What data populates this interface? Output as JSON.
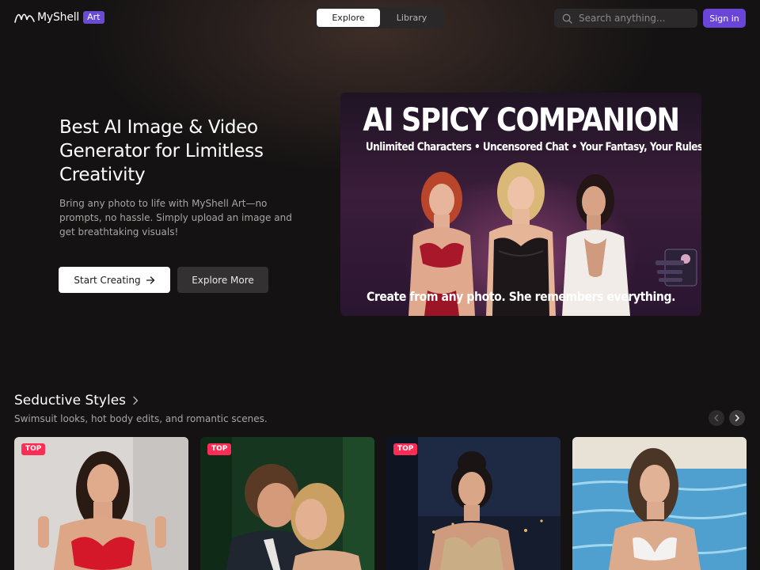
{
  "app": {
    "name": "MyShell",
    "badge": "Art"
  },
  "nav": {
    "tabs": [
      {
        "label": "Explore",
        "active": true
      },
      {
        "label": "Library",
        "active": false
      }
    ]
  },
  "search": {
    "placeholder": "Search anything...",
    "icon": "search-icon"
  },
  "auth": {
    "signin_label": "Sign in"
  },
  "hero": {
    "title_lines": [
      "Best AI Image & Video",
      "Generator for Limitless",
      "Creativity"
    ],
    "subtitle_lines": [
      "Bring any photo to life with MyShell Art—no",
      "prompts, no hassle. Simply upload an image and",
      "get breathtaking visuals!"
    ],
    "primary_button": "Start Creating",
    "secondary_button": "Explore More"
  },
  "banner": {
    "title": "AI SPICY COMPANION",
    "subtitle": "Unlimited Characters • Uncensored Chat • Your Fantasy, Your Rules",
    "caption": "Create from any photo. She remembers everything."
  },
  "section": {
    "title": "Seductive Styles",
    "subtitle": "Swimsuit looks, hot body edits, and romantic scenes.",
    "cards": [
      {
        "badge": "TOP"
      },
      {
        "badge": "TOP"
      },
      {
        "badge": "TOP"
      },
      {
        "badge": ""
      }
    ]
  },
  "colors": {
    "accent": "#6a45d9",
    "badge_red": "#ff2d55",
    "background": "#141213"
  }
}
